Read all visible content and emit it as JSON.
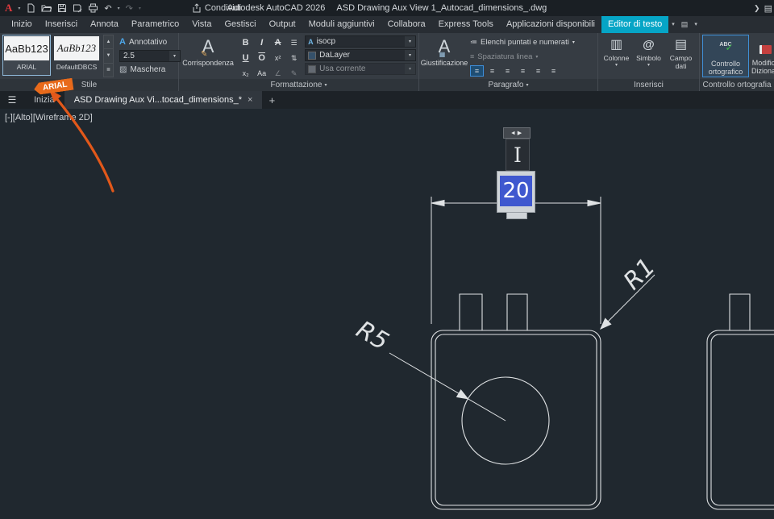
{
  "titlebar": {
    "app": "Autodesk AutoCAD 2026",
    "doc": "ASD Drawing Aux View 1_Autocad_dimensions_.dwg",
    "share": "Condividi",
    "logo": "A"
  },
  "tabs": [
    "Inizio",
    "Inserisci",
    "Annota",
    "Parametrico",
    "Vista",
    "Gestisci",
    "Output",
    "Moduli aggiuntivi",
    "Collabora",
    "Express Tools",
    "Applicazioni disponibili"
  ],
  "contextual_tab": "Editor di testo",
  "style_panel": {
    "label": "Stile",
    "style1_preview": "AaBb123",
    "style1_name": "ARIAL",
    "style2_preview": "AaBb123",
    "style2_name": "DefaultDBCS",
    "annotative": "Annotativo",
    "text_height": "2.5",
    "mask": "Maschera"
  },
  "format_panel": {
    "label": "Formattazione",
    "match": "Corrispondenza",
    "font": "isocp",
    "color": "DaLayer",
    "use_current": "Usa corrente"
  },
  "paragraph_panel": {
    "label": "Paragrafo",
    "justification": "Giustificazione",
    "lists": "Elenchi puntati e numerati",
    "line_spacing": "Spaziatura linea"
  },
  "insert_panel": {
    "label": "Inserisci",
    "columns": "Colonne",
    "symbol": "Simbolo",
    "field": "Campo dati"
  },
  "spell_panel": {
    "label": "Controllo ortografia",
    "check": "Controllo ortografico",
    "dict": "Modifica Dizionari",
    "abc": "ABC"
  },
  "file_tabs": {
    "start": "Inizia",
    "active": "ASD Drawing Aux Vi...tocad_dimensions_*"
  },
  "viewport_controls": "[-][Alto][Wireframe 2D]",
  "canvas": {
    "dim_text": "20",
    "r5": "R5",
    "r1": "R1",
    "arial_tag": "ARIAL"
  },
  "icons": {
    "dropdown": "▾",
    "hamburger": "☰",
    "close": "×",
    "plus": "+",
    "grip": "◄▶",
    "up": "▲",
    "down": "▼",
    "gallery": "≣",
    "undo": "↶",
    "redo": "↷",
    "chevron_right": "❯",
    "panel_toggle": "▤",
    "columns": "▥",
    "at": "@",
    "field": "▤",
    "tick": "✓",
    "bold": "B",
    "italic": "I",
    "strike": "A",
    "stacklist": "☰",
    "underline": "U",
    "overline": "O",
    "superscript": "x²",
    "subscript": "x₂",
    "case": "Aa",
    "stack": "⇅",
    "angle": "∠",
    "pencil": "✎",
    "big_a": "A",
    "mask": "▨",
    "grid": "▦",
    "bars": "≡",
    "listicon": "≔",
    "ibeam": "I"
  },
  "colors": {
    "contextual_tab": "#06a5c6",
    "canvas_bg": "#20282f",
    "line": "#dfe2e4",
    "selection_blue": "#3f58cf",
    "annotation_orange": "#e2581a",
    "spell_highlight": "#3f8fd6"
  }
}
